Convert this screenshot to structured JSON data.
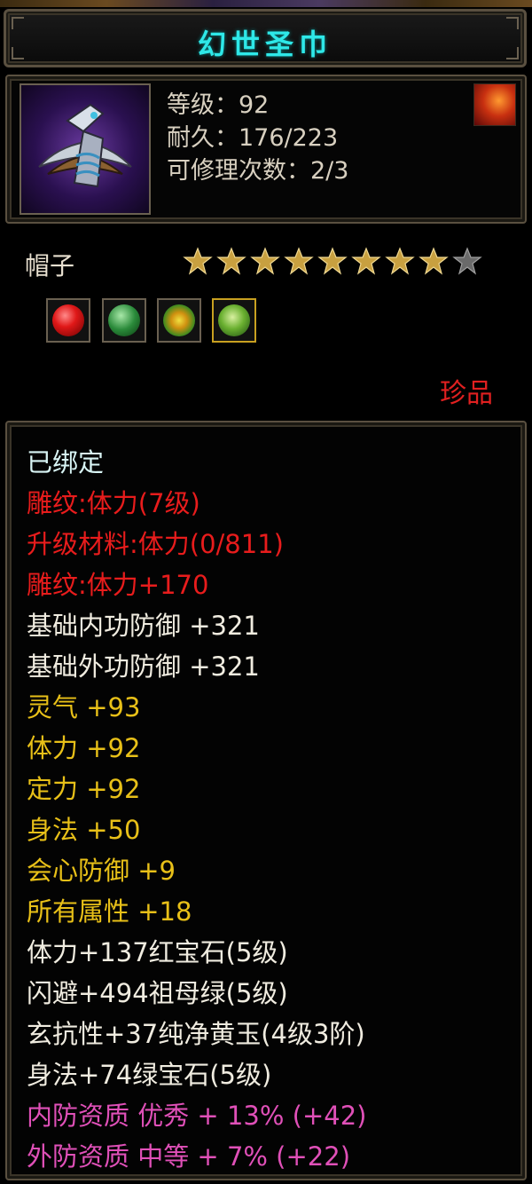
{
  "title": "幻世圣巾",
  "header": {
    "level_label": "等级：92",
    "durability_label": "耐久：176/223",
    "repair_label": "可修理次数：2/3"
  },
  "item_type": "帽子",
  "stars": {
    "filled": 8,
    "total": 9
  },
  "gems": [
    {
      "icon": "red-ruby-gem-icon",
      "color": "#e01818"
    },
    {
      "icon": "green-jade-ring-gem-icon",
      "color": "#2a8a3a"
    },
    {
      "icon": "yellow-jade-gem-icon",
      "color": "#d09010"
    },
    {
      "icon": "green-emerald-gem-icon",
      "color": "#6ab030"
    }
  ],
  "rarity": "珍品",
  "attributes": [
    {
      "text": "已绑定",
      "color": "bound"
    },
    {
      "text": "雕纹:体力(7级)",
      "color": "red"
    },
    {
      "text": "升级材料:体力(0/811)",
      "color": "red"
    },
    {
      "text": "雕纹:体力+170",
      "color": "red"
    },
    {
      "text": "基础内功防御 +321",
      "color": "white"
    },
    {
      "text": "基础外功防御 +321",
      "color": "white"
    },
    {
      "text": "灵气 +93",
      "color": "gold"
    },
    {
      "text": "体力 +92",
      "color": "gold"
    },
    {
      "text": "定力 +92",
      "color": "gold"
    },
    {
      "text": "身法 +50",
      "color": "gold"
    },
    {
      "text": "会心防御 +9",
      "color": "gold"
    },
    {
      "text": "所有属性 +18",
      "color": "gold"
    },
    {
      "text": "体力+137红宝石(5级)",
      "color": "white"
    },
    {
      "text": "闪避+494祖母绿(5级)",
      "color": "white"
    },
    {
      "text": "玄抗性+37纯净黄玉(4级3阶)",
      "color": "white"
    },
    {
      "text": "身法+74绿宝石(5级)",
      "color": "white"
    },
    {
      "text": "内防资质 优秀 + 13% (+42)",
      "color": "pink"
    },
    {
      "text": "外防资质 中等 + 7% (+22)",
      "color": "pink"
    }
  ],
  "colors": {
    "title": "#2ee8e8",
    "bound": "#d8f4f4",
    "red": "#e81c1c",
    "white": "#f0ece0",
    "gold": "#e8c018",
    "pink": "#e050b8",
    "border": "#5a5040"
  }
}
